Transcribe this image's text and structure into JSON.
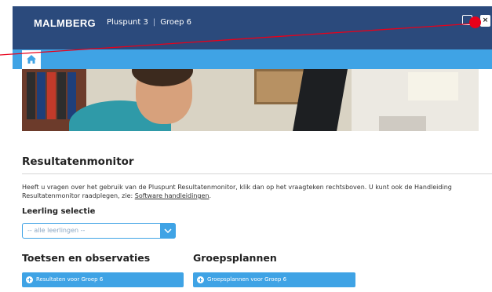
{
  "header": {
    "brand": "MALMBERG",
    "product": "Pluspunt 3",
    "separator": "|",
    "group": "Groep 6",
    "close_label": "×"
  },
  "page": {
    "title": "Resultatenmonitor",
    "intro_text": "Heeft u vragen over het gebruik van de Pluspunt Resultatenmonitor, klik dan op het vraagteken rechtsboven. U kunt ook de Handleiding Resultatenmonitor raadplegen, zie: ",
    "intro_link": "Software handleidingen",
    "intro_end": ".",
    "student_select_label": "Leerling selectie",
    "student_select_value": "-- alle leerlingen --"
  },
  "sections": {
    "tests_title": "Toetsen en observaties",
    "tests_button": "Resultaten voor Groep 6",
    "plans_title": "Groepsplannen",
    "plans_button": "Groepsplannen voor Groep 6"
  },
  "colors": {
    "topbar": "#2b4a7c",
    "accent": "#3fa3e5",
    "annotation": "#e8001a"
  },
  "icons": [
    "home-icon",
    "help-icon",
    "close-icon",
    "chevron-down-icon",
    "plus-circle-icon"
  ]
}
